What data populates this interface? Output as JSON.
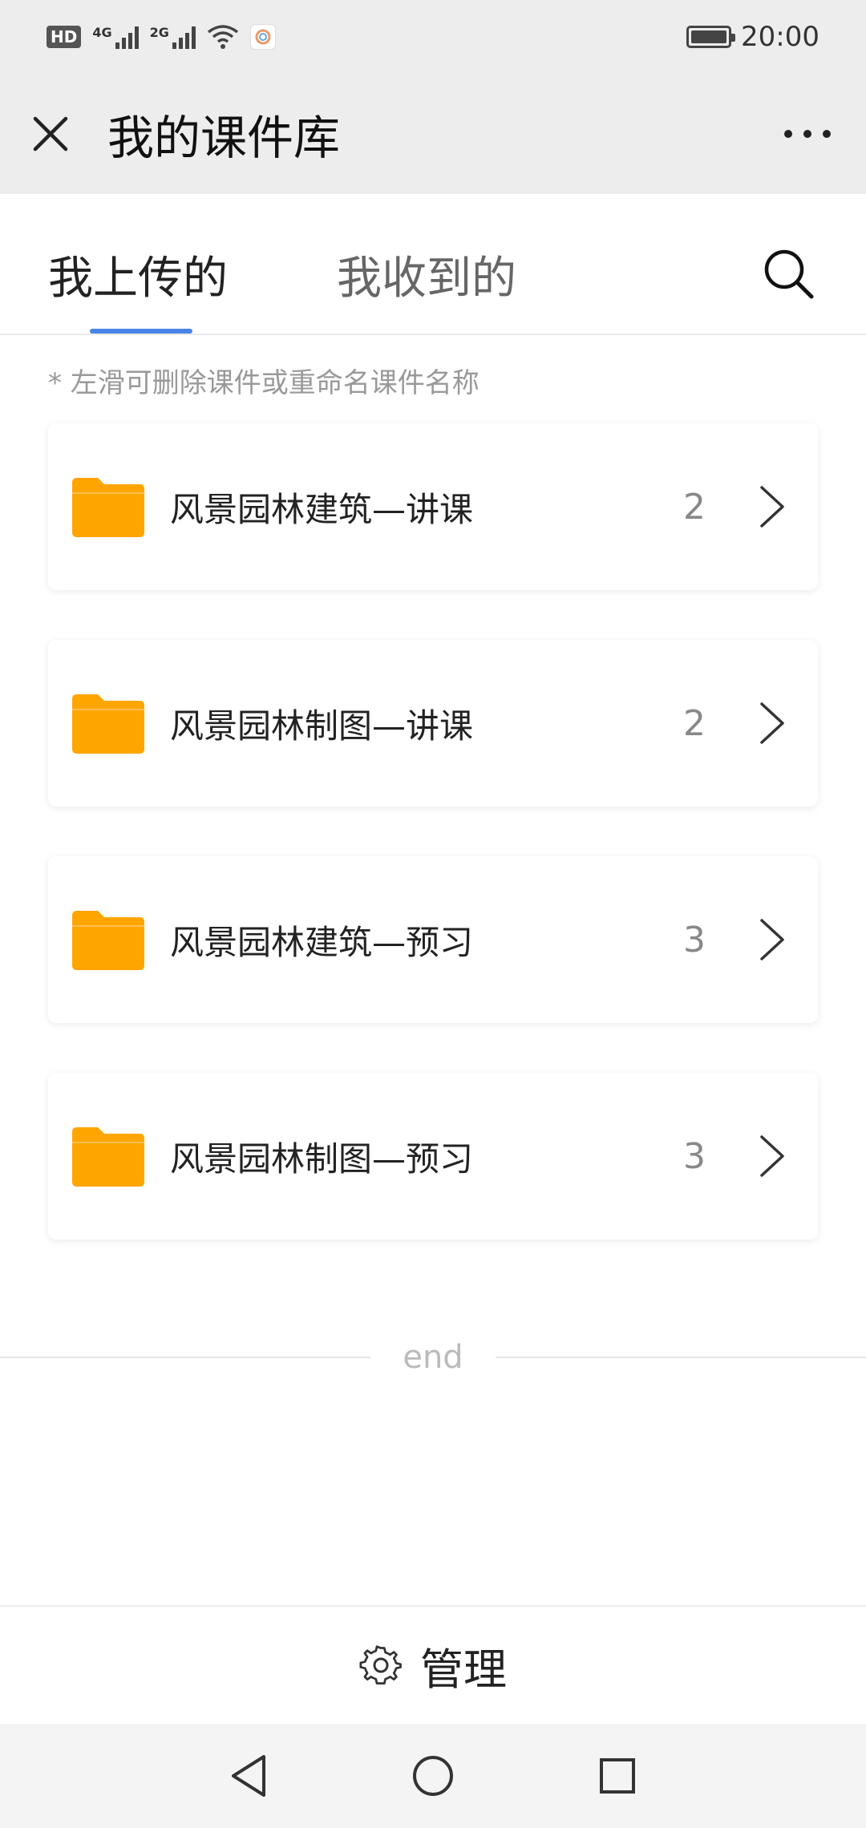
{
  "status_bar": {
    "hd": "HD",
    "net1": "4G",
    "net2": "2G",
    "time": "20:00"
  },
  "title_bar": {
    "title": "我的课件库"
  },
  "tabs": [
    {
      "label": "我上传的",
      "active": true
    },
    {
      "label": "我收到的",
      "active": false
    }
  ],
  "hint": "*  左滑可删除课件或重命名课件名称",
  "folders": [
    {
      "name": "风景园林建筑—讲课",
      "count": "2"
    },
    {
      "name": "风景园林制图—讲课",
      "count": "2"
    },
    {
      "name": "风景园林建筑—预习",
      "count": "3"
    },
    {
      "name": "风景园林制图—预习",
      "count": "3"
    }
  ],
  "end_label": "end",
  "manage": {
    "label": "管理"
  },
  "colors": {
    "accent": "#4a84e6",
    "folder": "#ffa500"
  },
  "icons": {
    "close": "close-icon",
    "more": "more-icon",
    "search": "search-icon",
    "folder": "folder-icon",
    "chevron": "chevron-right-icon",
    "gear": "gear-icon",
    "back": "back-icon",
    "home": "home-icon",
    "recents": "recents-icon"
  }
}
